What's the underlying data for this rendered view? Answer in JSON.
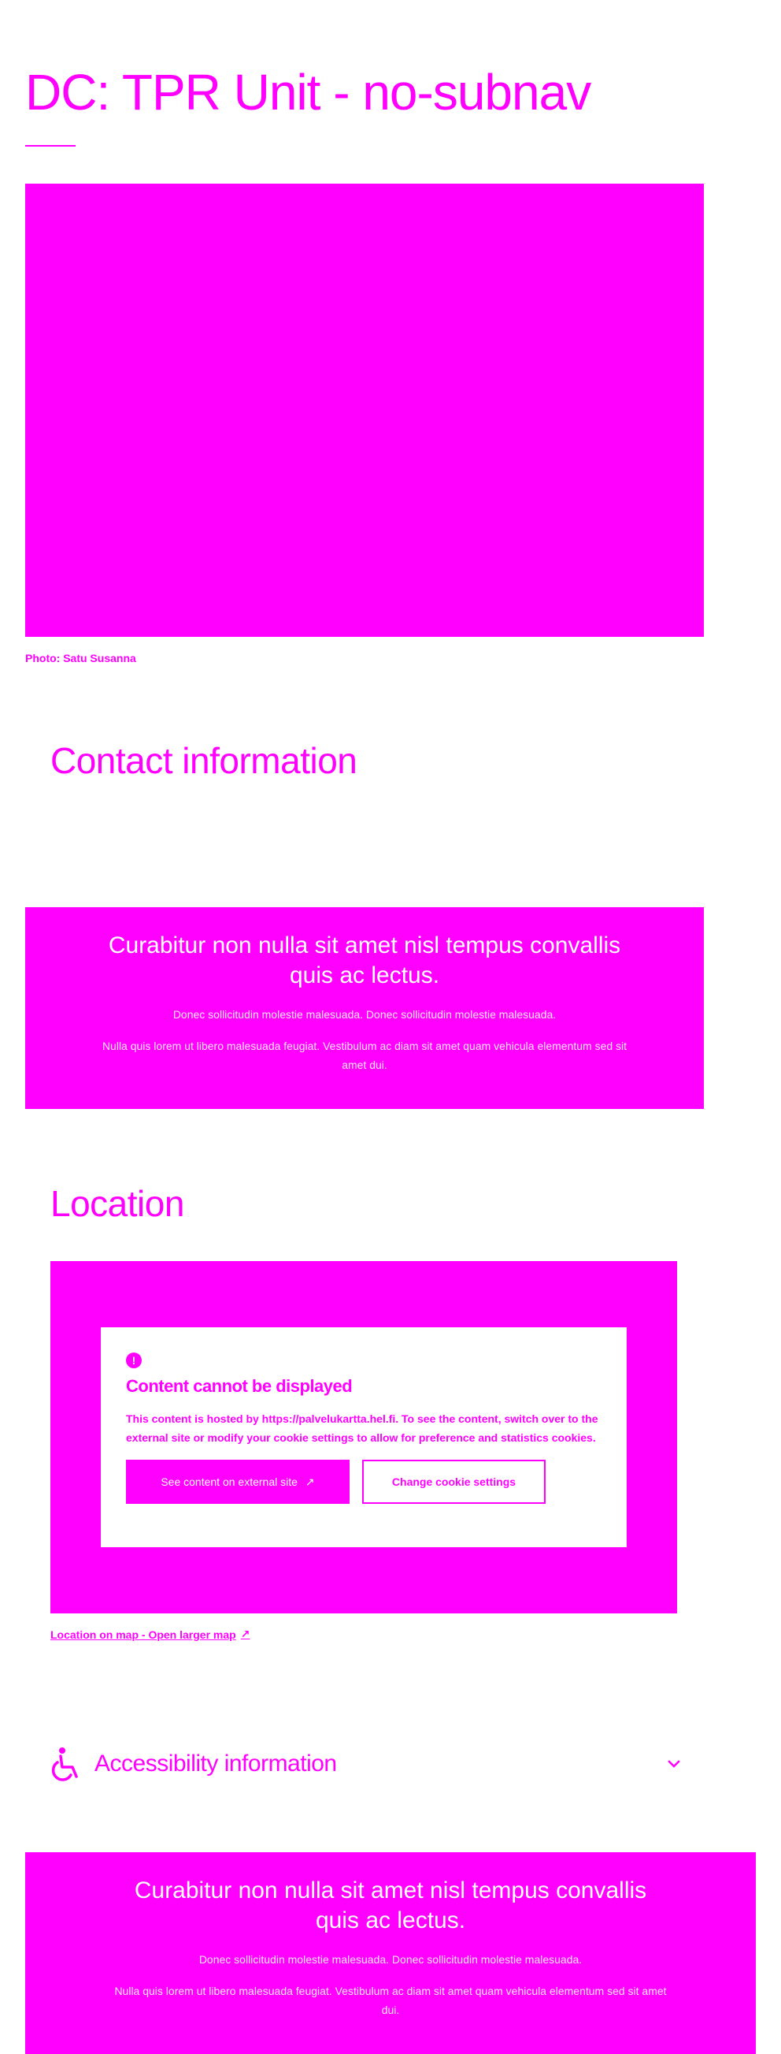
{
  "page": {
    "title": "DC: TPR Unit - no-subnav",
    "photo_credit": "Photo: Satu Susanna"
  },
  "sections": {
    "contact_heading": "Contact information",
    "location_heading": "Location"
  },
  "promo": {
    "title": "Curabitur non nulla sit amet nisl tempus convallis quis ac lectus.",
    "text1": "Donec sollicitudin molestie malesuada. Donec sollicitudin molestie malesuada.",
    "text2": "Nulla quis lorem ut libero malesuada feugiat. Vestibulum ac diam sit amet quam vehicula elementum sed sit amet dui."
  },
  "consent": {
    "title": "Content cannot be displayed",
    "text": "This content is hosted by https://palvelukartta.hel.fi. To see the content, switch over to the external site or modify your cookie settings to allow for preference and statistics cookies.",
    "external_button": "See content on external site",
    "settings_button": "Change cookie settings"
  },
  "map_link": "Location on map - Open larger map",
  "accessibility": {
    "title": "Accessibility information",
    "expanded": false
  },
  "icons": [
    "alert-icon",
    "external-link-icon",
    "wheelchair-icon",
    "chevron-down-icon"
  ],
  "colors": {
    "accent": "#ff00ff",
    "background": "#ffffff",
    "on_accent": "#ffffff"
  }
}
